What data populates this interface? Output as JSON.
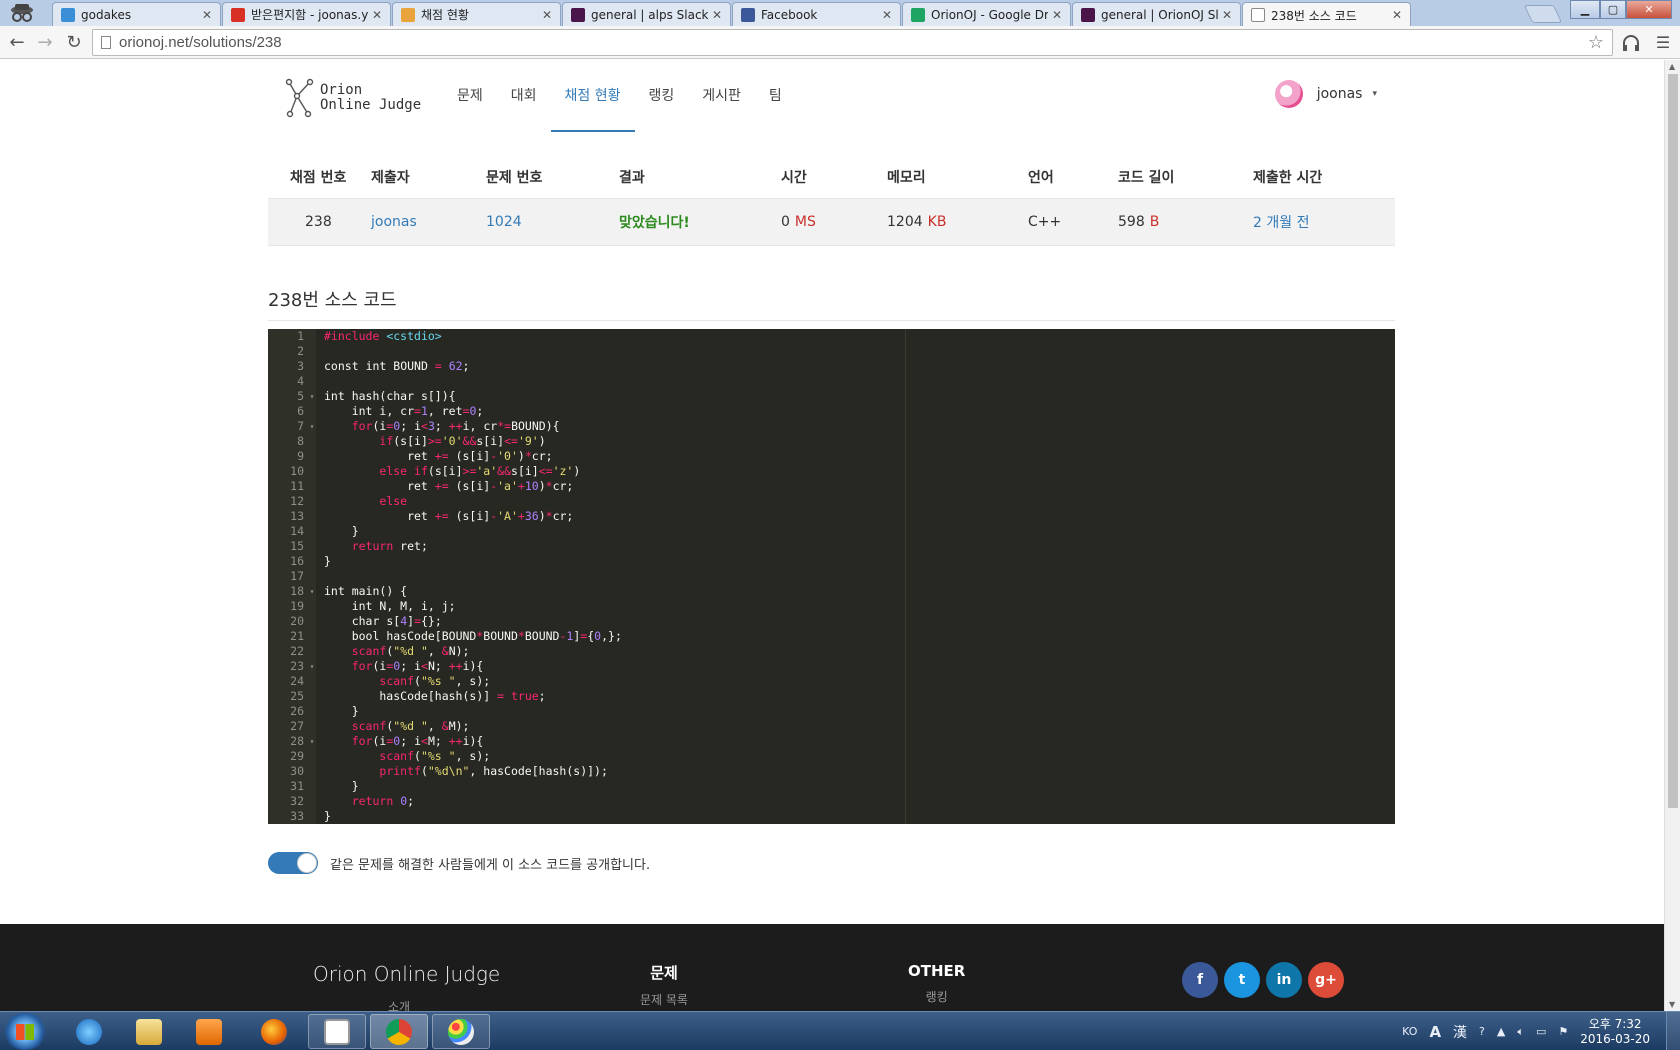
{
  "browser": {
    "tabs": [
      {
        "title": "godakes",
        "icon_color": "#3b8fd6",
        "icon": "chat-icon"
      },
      {
        "title": "받은편지함 - joonas.yoo",
        "icon_color": "#d93025",
        "icon": "gmail-icon"
      },
      {
        "title": "채점 현황",
        "icon_color": "#e8a33d",
        "icon": "orionoj-icon"
      },
      {
        "title": "general | alps Slack",
        "icon_color": "#4a154b",
        "icon": "slack-icon"
      },
      {
        "title": "Facebook",
        "icon_color": "#3b5998",
        "icon": "facebook-icon"
      },
      {
        "title": "OrionOJ - Google Drive",
        "icon_color": "#1fa463",
        "icon": "drive-icon"
      },
      {
        "title": "general | OrionOJ Slack",
        "icon_color": "#4a154b",
        "icon": "slack-icon"
      },
      {
        "title": "238번 소스 코드",
        "icon_color": "#ffffff",
        "icon": "page-icon"
      }
    ],
    "active_tab": 7,
    "url": "orionoj.net/solutions/238"
  },
  "site": {
    "logo_line1": "Orion",
    "logo_line2": "Online Judge",
    "nav": [
      "문제",
      "대회",
      "채점 현황",
      "랭킹",
      "게시판",
      "팀"
    ],
    "nav_active": 2,
    "username": "joonas",
    "caret": "▾"
  },
  "status": {
    "headers": [
      "채점 번호",
      "제출자",
      "문제 번호",
      "결과",
      "시간",
      "메모리",
      "언어",
      "코드 길이",
      "제출한 시간"
    ],
    "row": {
      "id": "238",
      "user": "joonas",
      "problem": "1024",
      "result": "맞았습니다!",
      "time": "0",
      "time_unit": "MS",
      "memory": "1204",
      "memory_unit": "KB",
      "language": "C++",
      "length": "598",
      "length_unit": "B",
      "submitted": "2 개월 전"
    }
  },
  "source": {
    "title": "238번 소스 코드",
    "fold_lines": [
      5,
      7,
      18,
      23,
      28
    ],
    "lines": [
      "#include <cstdio>",
      "",
      "const int BOUND = 62;",
      "",
      "int hash(char s[]){",
      "    int i, cr=1, ret=0;",
      "    for(i=0; i<3; ++i, cr*=BOUND){",
      "        if(s[i]>='0'&&s[i]<='9')",
      "            ret += (s[i]-'0')*cr;",
      "        else if(s[i]>='a'&&s[i]<='z')",
      "            ret += (s[i]-'a'+10)*cr;",
      "        else",
      "            ret += (s[i]-'A'+36)*cr;",
      "    }",
      "    return ret;",
      "}",
      "",
      "int main() {",
      "    int N, M, i, j;",
      "    char s[4]={};",
      "    bool hasCode[BOUND*BOUND*BOUND-1]={0,};",
      "    scanf(\"%d \", &N);",
      "    for(i=0; i<N; ++i){",
      "        scanf(\"%s \", s);",
      "        hasCode[hash(s)] = true;",
      "    }",
      "    scanf(\"%d \", &M);",
      "    for(i=0; i<M; ++i){",
      "        scanf(\"%s \", s);",
      "        printf(\"%d\\n\", hasCode[hash(s)]);",
      "    }",
      "    return 0;",
      "}"
    ],
    "public_label": "같은 문제를 해결한 사람들에게 이 소스 코드를 공개합니다.",
    "public_enabled": true
  },
  "footer": {
    "brand": "Orion Online Judge",
    "brand_sub": "소개",
    "col1_head": "문제",
    "col1_link": "문제 목록",
    "col2_head": "OTHER",
    "col2_link": "랭킹",
    "socials": [
      {
        "name": "facebook-icon",
        "glyph": "f",
        "color": "#3b5998"
      },
      {
        "name": "twitter-icon",
        "glyph": "t",
        "color": "#1b95e0"
      },
      {
        "name": "linkedin-icon",
        "glyph": "in",
        "color": "#0e76a8"
      },
      {
        "name": "google-plus-icon",
        "glyph": "g+",
        "color": "#dd4b39"
      }
    ]
  },
  "taskbar": {
    "lang": "KO",
    "ime_a": "A",
    "ime_han": "漢",
    "time": "오후 7:32",
    "date": "2016-03-20"
  }
}
